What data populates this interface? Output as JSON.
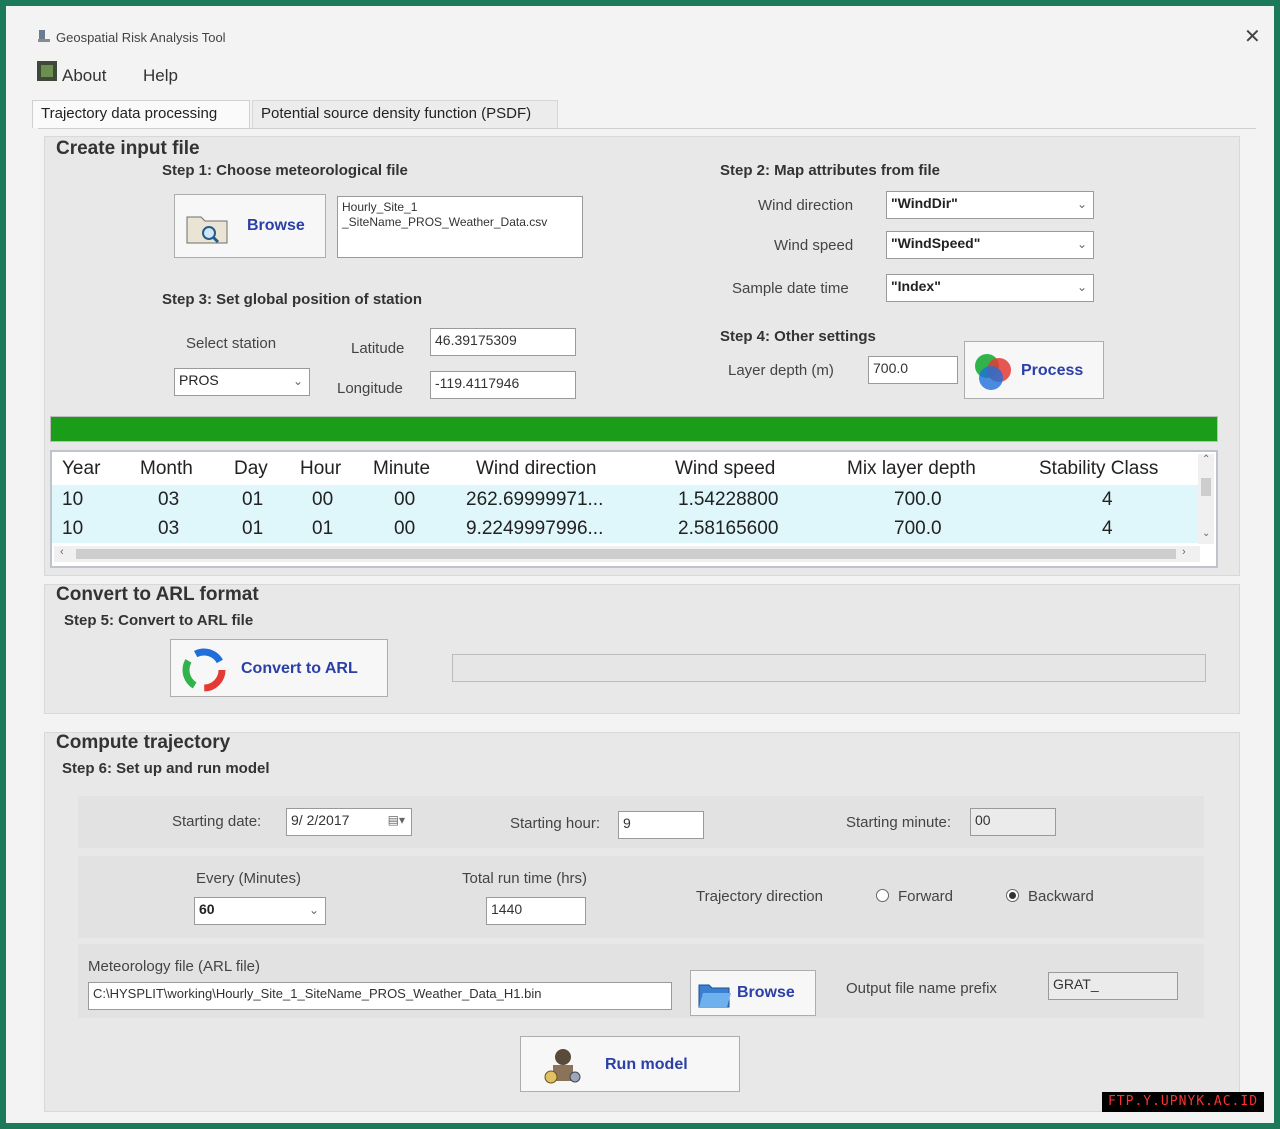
{
  "window": {
    "title": "Geospatial Risk Analysis Tool"
  },
  "menu": {
    "items": [
      "About",
      "Help"
    ]
  },
  "tabs": [
    "Trajectory data processing",
    "Potential source density function (PSDF)"
  ],
  "input_section": {
    "title": "Create input file",
    "step1": {
      "title": "Step 1: Choose meteorological file",
      "browse_label": "Browse",
      "file_line1": "Hourly_Site_1",
      "file_line2": "_SiteName_PROS_Weather_Data.csv"
    },
    "step2": {
      "title": "Step 2: Map attributes from file",
      "wind_dir_label": "Wind direction",
      "wind_dir_value": "\"WindDir\"",
      "wind_speed_label": "Wind speed",
      "wind_speed_value": "\"WindSpeed\"",
      "sample_label": "Sample date time",
      "sample_value": "\"Index\""
    },
    "step3": {
      "title": "Step 3: Set global position of station",
      "station_label": "Select station",
      "station_value": "PROS",
      "lat_label": "Latitude",
      "lat_value": "46.39175309",
      "lon_label": "Longitude",
      "lon_value": "-119.4117946"
    },
    "step4": {
      "title": "Step 4: Other settings",
      "layer_label": "Layer depth (m)",
      "layer_value": "700.0",
      "process_label": "Process"
    },
    "progress": 1.0,
    "progress_color": "#1a9e1a"
  },
  "grid": {
    "headers": [
      "Year",
      "Month",
      "Day",
      "Hour",
      "Minute",
      "Wind direction",
      "Wind speed",
      "Mix layer depth",
      "Stability Class"
    ],
    "rows": [
      [
        "10",
        "03",
        "01",
        "00",
        "00",
        "262.69999971...",
        "1.54228800",
        "700.0",
        "4"
      ],
      [
        "10",
        "03",
        "01",
        "01",
        "00",
        "9.2249997996...",
        "2.58165600",
        "700.0",
        "4"
      ]
    ]
  },
  "arl_section": {
    "title": "Convert to ARL format",
    "step5": "Step 5: Convert to ARL file",
    "convert_label": "Convert to ARL",
    "progress": 0
  },
  "traj_section": {
    "title": "Compute trajectory",
    "step6": "Step 6: Set up and run model",
    "start_date_label": "Starting date:",
    "start_date_value": "9/ 2/2017",
    "start_hour_label": "Starting hour:",
    "start_hour_value": "9",
    "start_minute_label": "Starting minute:",
    "start_minute_value": "00",
    "every_label": "Every (Minutes)",
    "every_value": "60",
    "total_label": "Total run time (hrs)",
    "total_value": "1440",
    "direction_label": "Trajectory direction",
    "forward_label": "Forward",
    "backward_label": "Backward",
    "direction_selected": "Backward",
    "met_label": "Meteorology file (ARL file)",
    "met_value": "C:\\HYSPLIT\\working\\Hourly_Site_1_SiteName_PROS_Weather_Data_H1.bin",
    "browse_label": "Browse",
    "prefix_label": "Output file name prefix",
    "prefix_value": "GRAT_",
    "run_label": "Run model"
  },
  "watermark": "FTP.Y.UPNYK.AC.ID"
}
